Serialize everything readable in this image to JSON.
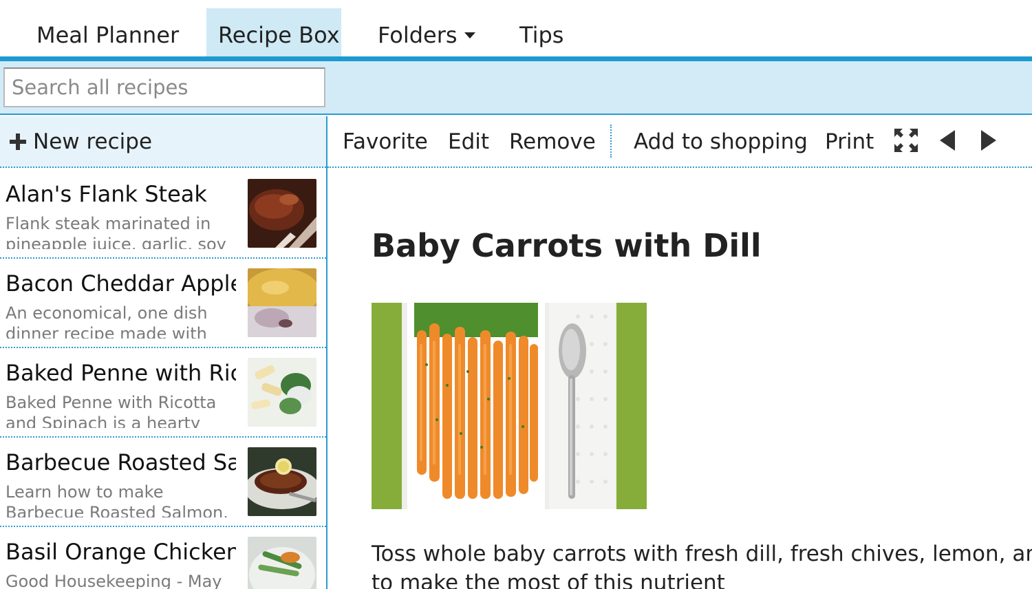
{
  "nav": {
    "tabs": [
      {
        "label": "Meal Planner",
        "active": false
      },
      {
        "label": "Recipe Box",
        "active": true
      },
      {
        "label": "Folders",
        "active": false,
        "has_dropdown": true
      },
      {
        "label": "Tips",
        "active": false
      }
    ]
  },
  "search": {
    "placeholder": "Search all recipes",
    "value": ""
  },
  "sidebar": {
    "new_recipe_label": "New recipe",
    "recipes": [
      {
        "title": "Alan's Flank Steak",
        "description": "Flank steak marinated in pineapple juice, garlic, soy",
        "thumb": "flank-steak-photo"
      },
      {
        "title": "Bacon Cheddar Apple",
        "description": "An economical, one dish dinner recipe made with",
        "thumb": "bacon-cheddar-apple-photo"
      },
      {
        "title": "Baked Penne with Ricc",
        "description": "Baked Penne with Ricotta and Spinach is a hearty",
        "thumb": "baked-penne-photo"
      },
      {
        "title": "Barbecue Roasted Salr",
        "description": "Learn how to make Barbecue Roasted Salmon. MyRecipes",
        "thumb": "salmon-photo"
      },
      {
        "title": "Basil Orange Chicken",
        "description": "Good Housekeeping - May",
        "thumb": "orange-chicken-photo"
      }
    ]
  },
  "toolbar": {
    "favorite": "Favorite",
    "edit": "Edit",
    "remove": "Remove",
    "add_to_shopping": "Add to shopping",
    "print": "Print",
    "icons": [
      "expand-icon",
      "previous-arrow-icon",
      "next-arrow-icon"
    ]
  },
  "recipe": {
    "title": "Baby Carrots with Dill",
    "image": "baby-carrots-photo",
    "intro": "Toss whole baby carrots with fresh dill, fresh chives, lemon, and butter to make the most of this nutrient"
  },
  "colors": {
    "accent": "#1d9ad1",
    "tab_active_bg": "#cfe9f5",
    "search_band_bg": "#d2ebf7",
    "sidebar_bar_bg": "#e7f3fa",
    "muted_text": "#7a7a7a"
  }
}
